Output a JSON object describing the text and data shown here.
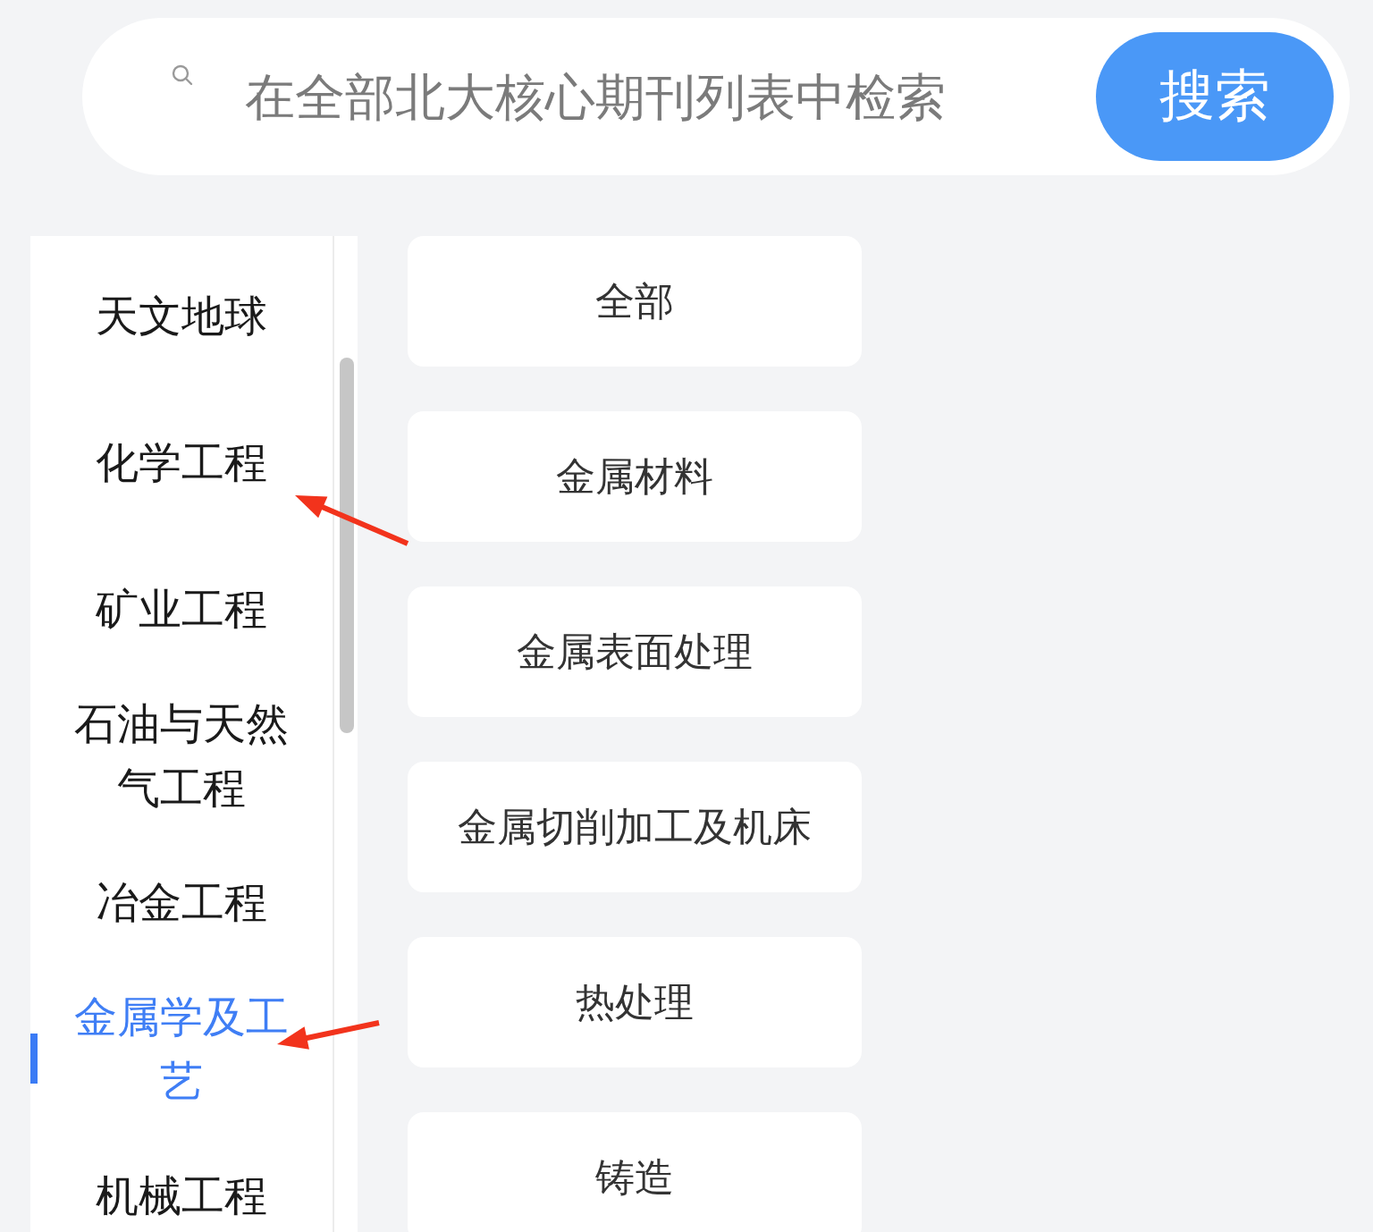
{
  "search": {
    "placeholder": "在全部北大核心期刊列表中检索",
    "button": "搜索"
  },
  "sidebar": {
    "items": [
      {
        "label": "天文地球",
        "selected": false
      },
      {
        "label": "化学工程",
        "selected": false
      },
      {
        "label": "矿业工程",
        "selected": false
      },
      {
        "label": "石油与天然气工程",
        "selected": false
      },
      {
        "label": "冶金工程",
        "selected": false
      },
      {
        "label": "金属学及工艺",
        "selected": true
      },
      {
        "label": "机械工程",
        "selected": false
      }
    ]
  },
  "subcategories": [
    "全部",
    "金属材料",
    "金属表面处理",
    "金属切削加工及机床",
    "热处理",
    "铸造"
  ]
}
